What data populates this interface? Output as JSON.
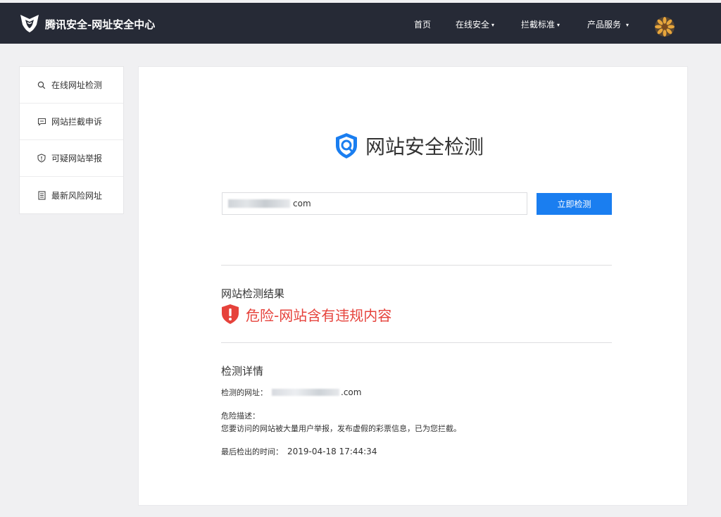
{
  "header": {
    "brand": "腾讯安全-网址安全中心",
    "nav": [
      {
        "label": "首页",
        "dropdown": false
      },
      {
        "label": "在线安全",
        "dropdown": true
      },
      {
        "label": "拦截标准",
        "dropdown": true
      },
      {
        "label": "产品服务",
        "dropdown": true
      }
    ],
    "caret": "▾",
    "avatar_icon": "avatar"
  },
  "sidebar": {
    "items": [
      {
        "label": "在线网址检测",
        "icon": "search-icon"
      },
      {
        "label": "网站拦截申诉",
        "icon": "message-icon"
      },
      {
        "label": "可疑网站举报",
        "icon": "shield-alert-icon"
      },
      {
        "label": "最新风险网址",
        "icon": "list-icon"
      }
    ]
  },
  "main": {
    "title": "网站安全检测",
    "search": {
      "value_suffix": "com",
      "button_label": "立即检测"
    },
    "result": {
      "heading": "网站检测结果",
      "status": "危险-网站含有违规内容"
    },
    "details": {
      "heading": "检测详情",
      "url_label": "检测的网址：",
      "url_suffix": ".com",
      "desc_label": "危险描述：",
      "desc_text": "您要访问的网站被大量用户举报，发布虚假的彩票信息，已为您拦截。",
      "time_label": "最后检出的时间：",
      "time_value": "2019-04-18 17:44:34"
    }
  },
  "colors": {
    "topbar": "#262a36",
    "accent": "#1a7ef0",
    "danger": "#e6423b",
    "background": "#f0f0f2"
  }
}
